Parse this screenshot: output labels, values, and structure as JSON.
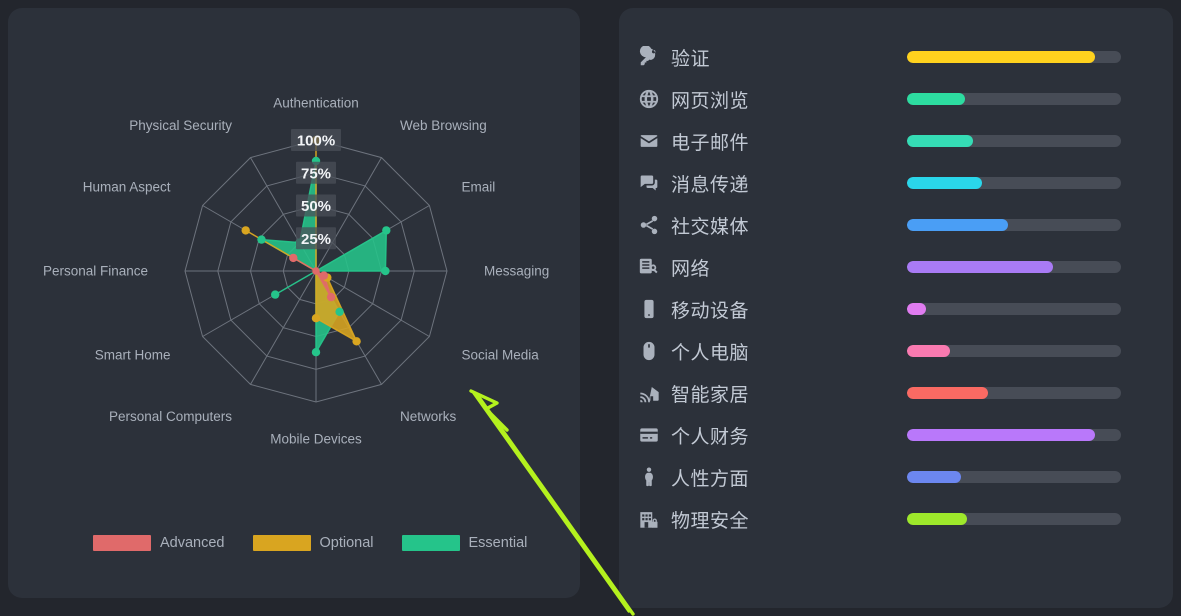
{
  "theme": {
    "page_bg": "#23262d",
    "card_bg": "#2c313a",
    "track_color": "#474c56",
    "label_color": "#c2c9d4",
    "axis_label_color": "#a9b0bb",
    "annotation_color": "#b4f11e"
  },
  "chart_data": {
    "type": "radar",
    "title": "",
    "categories": [
      "Authentication",
      "Web Browsing",
      "Email",
      "Messaging",
      "Social Media",
      "Networks",
      "Mobile Devices",
      "Personal Computers",
      "Smart Home",
      "Personal Finance",
      "Human Aspect",
      "Physical Security"
    ],
    "tick_labels": [
      "25%",
      "50%",
      "75%",
      "100%"
    ],
    "ticks": [
      25,
      50,
      75,
      100
    ],
    "rmax": 100,
    "grid": true,
    "legend_position": "bottom-left",
    "series": [
      {
        "name": "Essential",
        "color": "#25c48a",
        "values": [
          84,
          0,
          62,
          53,
          0,
          36,
          62,
          0,
          36,
          0,
          48,
          25
        ]
      },
      {
        "name": "Optional",
        "color": "#d9a520",
        "values": [
          100,
          0,
          0,
          0,
          10,
          62,
          36,
          0,
          0,
          0,
          62,
          0
        ]
      },
      {
        "name": "Advanced",
        "color": "#e06a6a",
        "values": [
          0,
          0,
          0,
          0,
          7,
          23,
          0,
          0,
          0,
          0,
          20,
          0
        ]
      }
    ]
  },
  "legend": {
    "items": [
      {
        "label": "Advanced",
        "color": "#e06a6a"
      },
      {
        "label": "Optional",
        "color": "#d9a520"
      },
      {
        "label": "Essential",
        "color": "#25c48a"
      }
    ]
  },
  "list": {
    "rows": [
      {
        "label": "验证",
        "icon": "key-icon",
        "value": 88,
        "color": "#ffd21e"
      },
      {
        "label": "网页浏览",
        "icon": "globe-icon",
        "value": 27,
        "color": "#2ddca0"
      },
      {
        "label": "电子邮件",
        "icon": "envelope-icon",
        "value": 31,
        "color": "#35dcb5"
      },
      {
        "label": "消息传递",
        "icon": "chat-bubble-icon",
        "value": 35,
        "color": "#2ad6ea"
      },
      {
        "label": "社交媒体",
        "icon": "share-icon",
        "value": 47,
        "color": "#4a9ef5"
      },
      {
        "label": "网络",
        "icon": "network-server-icon",
        "value": 68,
        "color": "#a97bf5"
      },
      {
        "label": "移动设备",
        "icon": "smartphone-icon",
        "value": 9,
        "color": "#e07cf0"
      },
      {
        "label": "个人电脑",
        "icon": "mouse-icon",
        "value": 20,
        "color": "#f97ab0"
      },
      {
        "label": "智能家居",
        "icon": "smart-home-icon",
        "value": 38,
        "color": "#fa6a63"
      },
      {
        "label": "个人财务",
        "icon": "credit-card-icon",
        "value": 88,
        "color": "#b978fa"
      },
      {
        "label": "人性方面",
        "icon": "person-icon",
        "value": 25,
        "color": "#6c87f0"
      },
      {
        "label": "物理安全",
        "icon": "building-lock-icon",
        "value": 28,
        "color": "#9ee82b"
      }
    ]
  }
}
